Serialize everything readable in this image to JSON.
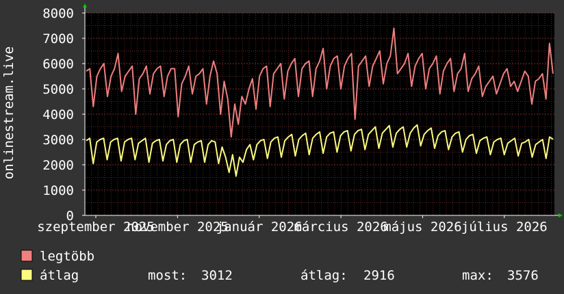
{
  "chart_data": {
    "type": "line",
    "ylabel": "onlinestream.live",
    "ylim": [
      0,
      8000
    ],
    "y_ticks": [
      0,
      1000,
      2000,
      3000,
      4000,
      5000,
      6000,
      7000,
      8000
    ],
    "x_tick_labels": [
      "szeptember 2025",
      "november 2025",
      "január 2026",
      "március 2026",
      "május 2026",
      "július 2026"
    ],
    "grid": true,
    "legend_placement": "bottom-left",
    "colors": {
      "background": "#333333",
      "plot": "#000000",
      "grid": "#5a2a2a",
      "axis": "#ffffff",
      "arrow": "#00cc00",
      "series_max": "#f07f7f",
      "series_avg": "#fbfb7f"
    },
    "series": [
      {
        "name": "legtöbb",
        "color": "#f07f7f",
        "values": [
          5700,
          5800,
          4300,
          5500,
          5800,
          6000,
          4700,
          5500,
          5800,
          6400,
          4900,
          5500,
          5700,
          5900,
          4000,
          5400,
          5600,
          5900,
          4800,
          5600,
          5800,
          5900,
          4700,
          5500,
          5800,
          5800,
          3900,
          5200,
          5500,
          5900,
          4800,
          5500,
          5600,
          5800,
          4400,
          5500,
          6100,
          5600,
          4000,
          5300,
          4600,
          3100,
          4400,
          3600,
          4700,
          4400,
          5000,
          5400,
          4200,
          5500,
          5800,
          5900,
          4300,
          5600,
          5800,
          6000,
          4600,
          5700,
          6000,
          6200,
          4700,
          5800,
          6000,
          6100,
          4700,
          5800,
          6100,
          6600,
          5000,
          5900,
          6200,
          6300,
          5000,
          5900,
          6200,
          6400,
          3800,
          5900,
          6100,
          6300,
          5100,
          5900,
          6200,
          6500,
          5200,
          6000,
          6300,
          7400,
          5600,
          5800,
          6000,
          6400,
          5100,
          5900,
          6200,
          6400,
          5000,
          5800,
          6000,
          6300,
          4800,
          5700,
          6000,
          6200,
          4900,
          5600,
          5800,
          6400,
          4900,
          5400,
          5600,
          5900,
          4700,
          5100,
          5300,
          5500,
          4800,
          5200,
          5600,
          5800,
          5100,
          5300,
          4900,
          5300,
          5700,
          5500,
          4400,
          5300,
          5400,
          5600,
          4600,
          6800,
          5600
        ]
      },
      {
        "name": "átlag",
        "color": "#fbfb7f",
        "values": [
          2950,
          3050,
          2050,
          2900,
          3000,
          3050,
          2200,
          2900,
          3000,
          3050,
          2150,
          2900,
          3000,
          3050,
          2200,
          2850,
          2950,
          3050,
          2100,
          2850,
          2950,
          3000,
          2150,
          2800,
          2950,
          3000,
          2100,
          2800,
          2950,
          3000,
          2100,
          2800,
          2900,
          2950,
          2100,
          2800,
          2950,
          2900,
          2050,
          2700,
          2300,
          1700,
          2400,
          1550,
          2300,
          2100,
          2600,
          2800,
          2200,
          2800,
          2950,
          3000,
          2250,
          2900,
          3050,
          3100,
          2300,
          2950,
          3100,
          3200,
          2350,
          3000,
          3150,
          3250,
          2400,
          3050,
          3200,
          3300,
          2450,
          3100,
          3250,
          3300,
          2500,
          3150,
          3300,
          3350,
          2550,
          3200,
          3350,
          3400,
          2600,
          3200,
          3350,
          3500,
          2650,
          3250,
          3400,
          3550,
          2700,
          3250,
          3400,
          3500,
          2700,
          3250,
          3450,
          3576,
          2750,
          3200,
          3350,
          3450,
          2650,
          3150,
          3300,
          3350,
          2600,
          3100,
          3250,
          3300,
          2500,
          3000,
          3150,
          3200,
          2450,
          2950,
          3050,
          3100,
          2400,
          2900,
          3000,
          3050,
          2400,
          2850,
          2950,
          3050,
          2350,
          2850,
          2900,
          3000,
          2300,
          2800,
          2900,
          3000,
          2250,
          3100,
          3012
        ]
      }
    ],
    "legend": [
      {
        "label": "legtöbb",
        "color": "#f07f7f"
      },
      {
        "label": "átlag",
        "color": "#fbfb7f",
        "stats": [
          {
            "label": "most:",
            "value": "3012"
          },
          {
            "label": "átlag:",
            "value": "2916"
          },
          {
            "label": "max:",
            "value": "3576"
          }
        ]
      }
    ]
  }
}
